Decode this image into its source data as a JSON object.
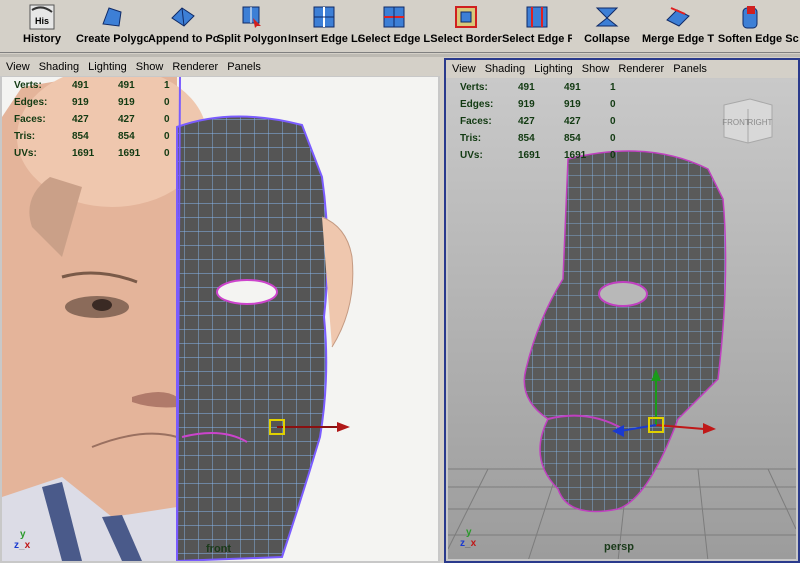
{
  "shelf": {
    "items": [
      {
        "label": "History",
        "icon": "history-icon",
        "icon_text": "His"
      },
      {
        "label": "Create Polygo",
        "icon": "create-polygon-icon"
      },
      {
        "label": "Append to Pol",
        "icon": "append-polygon-icon"
      },
      {
        "label": "Split Polygon",
        "icon": "split-polygon-icon"
      },
      {
        "label": "Insert Edge Lc",
        "icon": "insert-edge-loop-icon"
      },
      {
        "label": "Select Edge L",
        "icon": "select-edge-loop-icon"
      },
      {
        "label": "Select Border",
        "icon": "select-border-icon"
      },
      {
        "label": "Select Edge R",
        "icon": "select-edge-ring-icon"
      },
      {
        "label": "Collapse",
        "icon": "collapse-icon"
      },
      {
        "label": "Merge Edge T",
        "icon": "merge-edge-icon"
      },
      {
        "label": "Soften Edge",
        "icon": "soften-edge-icon"
      },
      {
        "label": "Sc",
        "icon": "scale-icon"
      }
    ]
  },
  "panel_menu": [
    "View",
    "Shading",
    "Lighting",
    "Show",
    "Renderer",
    "Panels"
  ],
  "hud": [
    {
      "key": "Verts:",
      "a": "491",
      "b": "491",
      "c": "1"
    },
    {
      "key": "Edges:",
      "a": "919",
      "b": "919",
      "c": "0"
    },
    {
      "key": "Faces:",
      "a": "427",
      "b": "427",
      "c": "0"
    },
    {
      "key": "Tris:",
      "a": "854",
      "b": "854",
      "c": "0"
    },
    {
      "key": "UVs:",
      "a": "1691",
      "b": "1691",
      "c": "0"
    }
  ],
  "left_view": {
    "camera": "front"
  },
  "right_view": {
    "camera": "persp",
    "viewcube_front": "FRONT",
    "viewcube_right": "RIGHT"
  },
  "axis_labels": {
    "y": "y",
    "z": "z",
    "x": "x"
  }
}
